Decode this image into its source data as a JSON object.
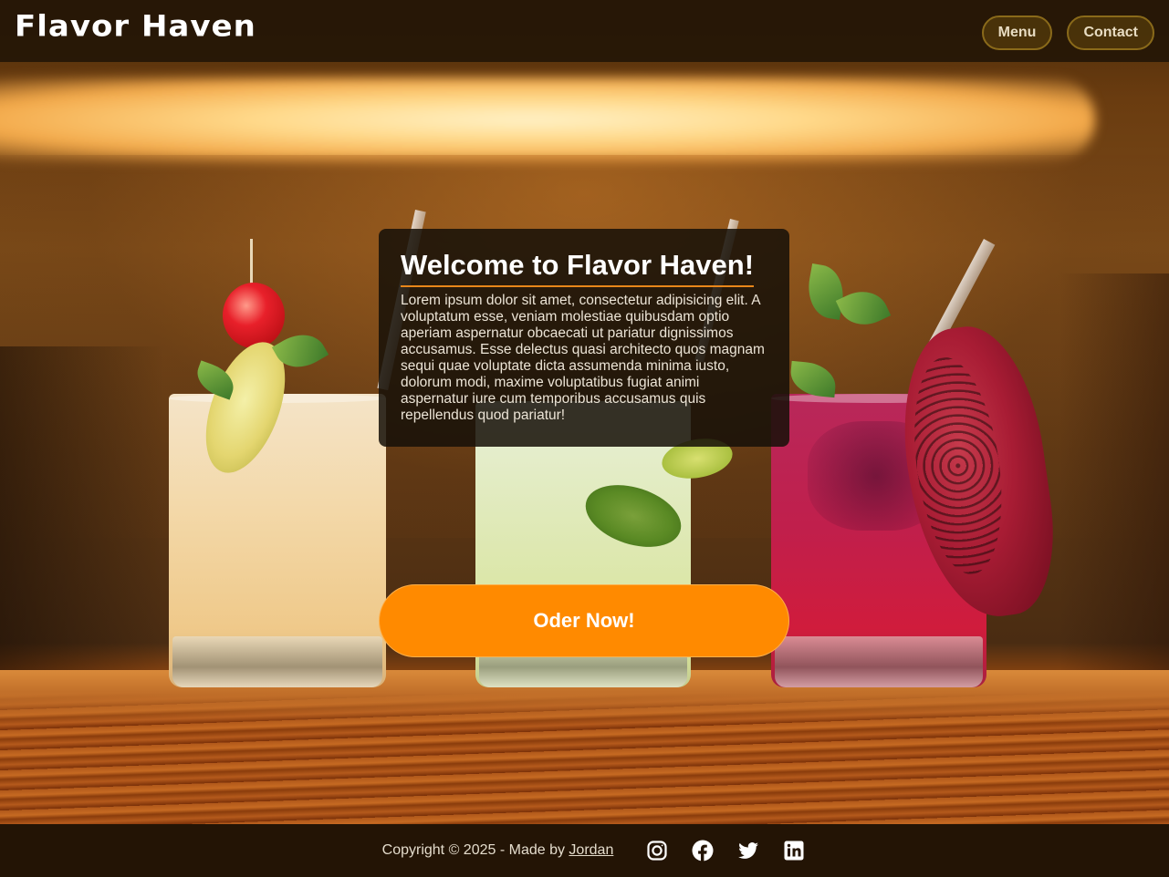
{
  "header": {
    "logo": "Flavor Haven",
    "nav": [
      {
        "label": "Menu"
      },
      {
        "label": "Contact"
      }
    ]
  },
  "hero": {
    "title": "Welcome to Flavor Haven!",
    "body": "Lorem ipsum dolor sit amet, consectetur adipisicing elit. A voluptatum esse, veniam molestiae quibusdam optio aperiam aspernatur obcaecati ut pariatur dignissimos accusamus. Esse delectus quasi architecto quos magnam sequi quae voluptate dicta assumenda minima iusto, dolorum modi, maxime voluptatibus fugiat animi aspernatur iure cum temporibus accusamus quis repellendus quod pariatur!",
    "cta_label": "Oder Now!"
  },
  "footer": {
    "copyright_prefix": "Copyright © 2025 - Made by ",
    "author": "Jordan",
    "social_icons": [
      "instagram-icon",
      "facebook-icon",
      "twitter-icon",
      "linkedin-icon"
    ]
  },
  "colors": {
    "accent": "#ff8a00",
    "header_bg": "#241606",
    "footer_bg": "#231405",
    "card_bg": "#161008"
  }
}
